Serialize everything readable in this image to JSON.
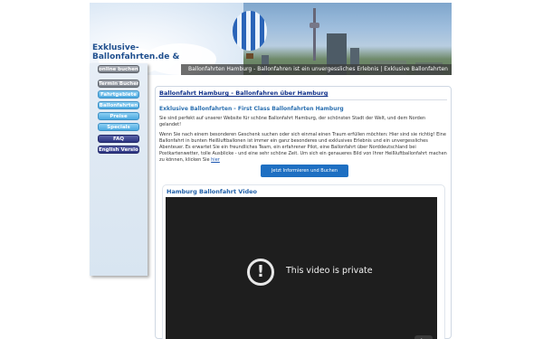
{
  "header": {
    "logo_line1": "Exklusive-",
    "logo_line2": "Ballonfahrten.de &",
    "ticker": "Ballonfahrten Hamburg - Ballonfahren ist ein unvergessliches Erlebnis | Exklusive Ballonfahrten"
  },
  "sidebar": {
    "buttons": [
      {
        "label": "online buchen",
        "style": "gray"
      },
      {
        "label": "Termin Buchen",
        "style": "gray"
      },
      {
        "label": "Fahrtgebiete",
        "style": "light"
      },
      {
        "label": "Ballonfahrten",
        "style": "light"
      },
      {
        "label": "Preise",
        "style": "light"
      },
      {
        "label": "Specials",
        "style": "light"
      },
      {
        "label": "FAQ",
        "style": "dark"
      },
      {
        "label": "English Version",
        "style": "dark"
      }
    ]
  },
  "content": {
    "main_heading": "Ballonfahrt Hamburg - Ballonfahren über Hamburg",
    "sub_heading": "Exklusive Ballonfahrten - First Class Ballonfahrten Hamburg",
    "para1": "Sie sind perfekt auf unserer Website für schöne Ballonfahrt Hamburg, der schönsten Stadt der Welt, und dem Norden gelandet!",
    "para2": "Wenn Sie nach einem besonderen Geschenk suchen oder sich einmal einen Traum erfüllen möchten: Hier sind sie richtig! Eine Ballonfahrt in bunten Heißluftballonen ist immer ein ganz besonderes und exklusives Erlebnis und ein unvergessliches Abenteuer. Es erwartet Sie ein freundliches Team, ein erfahrener Pilot, eine Ballonfahrt über Norddeutschland bei Postkartenwetter, tolle Ausblicke - und eine sehr schöne Zeit. Um sich ein genaueres Bild von Ihrer Heißluftballonfahrt machen zu können, klicken Sie",
    "para2_link": "hier",
    "cta_label": "Jetzt Informieren und Buchen",
    "video_title": "Hamburg Ballonfahrt Video",
    "video_message": "This video is private"
  },
  "icons": {
    "private": "exclamation-circle-icon",
    "youtube": "youtube-logo-icon"
  },
  "colors": {
    "heading": "#10308a",
    "subheading": "#2a6fb0",
    "cta": "#1e6fc2"
  }
}
